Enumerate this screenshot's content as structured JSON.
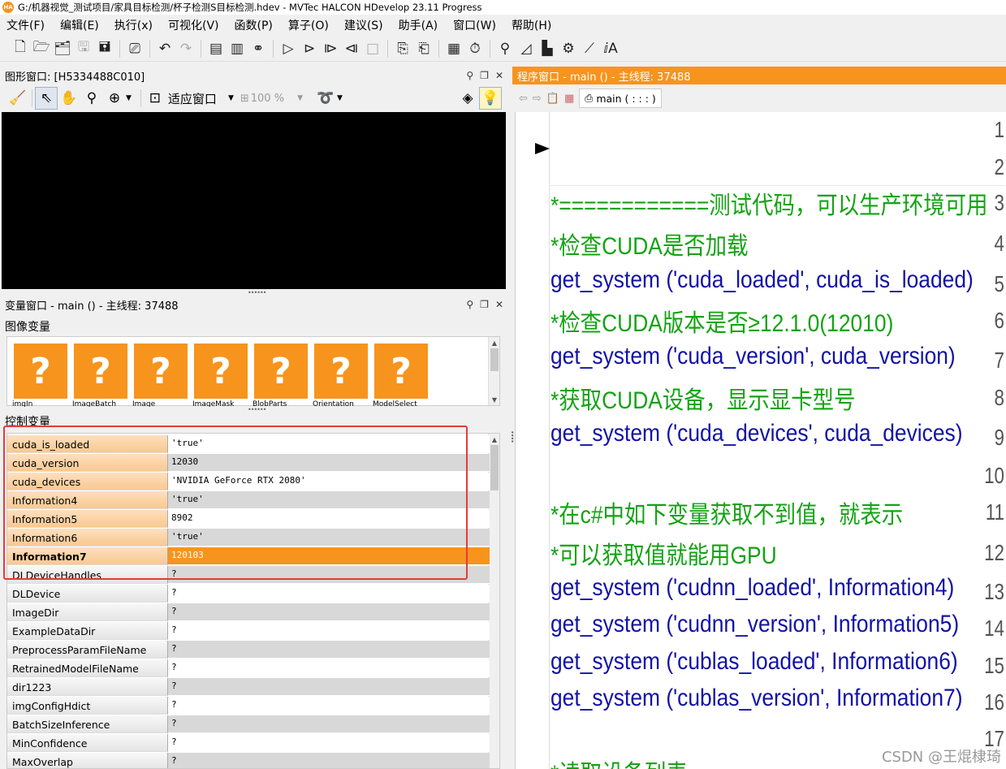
{
  "window": {
    "logo": "HA",
    "title": "G:/机器视觉_测试项目/家具目标检测/杯子检测S目标检测.hdev - MVTec HALCON HDevelop 23.11 Progress"
  },
  "menu": [
    "文件(F)",
    "编辑(E)",
    "执行(x)",
    "可视化(V)",
    "函数(P)",
    "算子(O)",
    "建议(S)",
    "助手(A)",
    "窗口(W)",
    "帮助(H)"
  ],
  "graphics": {
    "title": "图形窗口: [H5334488C010]",
    "fit_label": "适应窗口",
    "zoom": "100 %"
  },
  "variables": {
    "title": "变量窗口 - main () - 主线程: 37488",
    "iconic_section": "图像变量",
    "control_section": "控制变量",
    "iconic": [
      {
        "symbol": "?",
        "label": "imgIn"
      },
      {
        "symbol": "?",
        "label": "ImageBatch"
      },
      {
        "symbol": "?",
        "label": "Image"
      },
      {
        "symbol": "?",
        "label": "ImageMask"
      },
      {
        "symbol": "?",
        "label": "BlobParts"
      },
      {
        "symbol": "?",
        "label": "Orientation"
      },
      {
        "symbol": "?",
        "label": "ModelSelect"
      }
    ],
    "control": [
      {
        "name": "cuda_is_loaded",
        "value": "'true'"
      },
      {
        "name": "cuda_version",
        "value": "12030"
      },
      {
        "name": "cuda_devices",
        "value": "'NVIDIA GeForce RTX 2080'"
      },
      {
        "name": "Information4",
        "value": "'true'"
      },
      {
        "name": "Information5",
        "value": "8902"
      },
      {
        "name": "Information6",
        "value": "'true'"
      },
      {
        "name": "Information7",
        "value": "120103"
      },
      {
        "name": "DLDeviceHandles",
        "value": "?"
      },
      {
        "name": "DLDevice",
        "value": "?"
      },
      {
        "name": "ImageDir",
        "value": "?"
      },
      {
        "name": "ExampleDataDir",
        "value": "?"
      },
      {
        "name": "PreprocessParamFileName",
        "value": "?"
      },
      {
        "name": "RetrainedModelFileName",
        "value": "?"
      },
      {
        "name": "dir1223",
        "value": "?"
      },
      {
        "name": "imgConfigHdict",
        "value": "?"
      },
      {
        "name": "BatchSizeInference",
        "value": "?"
      },
      {
        "name": "MinConfidence",
        "value": "?"
      },
      {
        "name": "MaxOverlap",
        "value": "?"
      }
    ]
  },
  "program": {
    "title": "程序窗口 - main () - 主线程: 37488",
    "tab_label": "main ( : : : )",
    "lines": [
      {
        "n": "1",
        "text": "",
        "kind": "op"
      },
      {
        "n": "2",
        "text": "",
        "kind": "op"
      },
      {
        "n": "3",
        "text": "*============测试代码，可以生产环境可用",
        "kind": "cmt"
      },
      {
        "n": "4",
        "text": "*检查CUDA是否加载",
        "kind": "cmt"
      },
      {
        "n": "5",
        "text": "get_system ('cuda_loaded', cuda_is_loaded)",
        "kind": "op"
      },
      {
        "n": "6",
        "text": "*检查CUDA版本是否≥12.1.0(12010)",
        "kind": "cmt"
      },
      {
        "n": "7",
        "text": "get_system ('cuda_version', cuda_version)",
        "kind": "op"
      },
      {
        "n": "8",
        "text": "*获取CUDA设备，显示显卡型号",
        "kind": "cmt"
      },
      {
        "n": "9",
        "text": "get_system ('cuda_devices', cuda_devices)",
        "kind": "op"
      },
      {
        "n": "10",
        "text": "",
        "kind": "op"
      },
      {
        "n": "11",
        "text": "*在c#中如下变量获取不到值，就表示",
        "kind": "cmt"
      },
      {
        "n": "12",
        "text": "*可以获取值就能用GPU",
        "kind": "cmt"
      },
      {
        "n": "13",
        "text": "get_system ('cudnn_loaded', Information4)",
        "kind": "op"
      },
      {
        "n": "14",
        "text": "get_system ('cudnn_version', Information5)",
        "kind": "op"
      },
      {
        "n": "15",
        "text": "get_system ('cublas_loaded', Information6)",
        "kind": "op"
      },
      {
        "n": "16",
        "text": "get_system ('cublas_version', Information7)",
        "kind": "op"
      },
      {
        "n": "17",
        "text": "",
        "kind": "op"
      },
      {
        "n": "",
        "text": "*读取设备列表",
        "kind": "cmt"
      }
    ]
  },
  "watermark": "CSDN @王焜棣琦"
}
